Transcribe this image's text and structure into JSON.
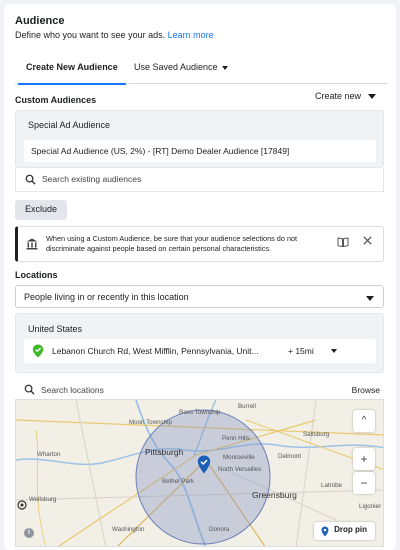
{
  "header": {
    "title": "Audience",
    "subtitle": "Define who you want to see your ads.",
    "learn_more": "Learn more"
  },
  "tabs": [
    {
      "label": "Create New Audience",
      "active": true
    },
    {
      "label": "Use Saved Audience",
      "active": false
    }
  ],
  "custom_audiences": {
    "label": "Custom Audiences",
    "create_new": "Create new",
    "box_label": "Special Ad Audience",
    "selected": "Special Ad Audience (US, 2%) - [RT] Demo Dealer Audience [17849]",
    "search_placeholder": "Search existing audiences",
    "exclude_label": "Exclude"
  },
  "notice": {
    "text": "When using a Custom Audience, be sure that your audience selections do not discriminate against people based on certain personal characteristics."
  },
  "locations": {
    "label": "Locations",
    "type_selected": "People living in or recently in this location",
    "country": "United States",
    "location_name": "Lebanon Church Rd, West Mifflin, Pennsylvania, Unit...",
    "radius": "+ 15mi",
    "search_placeholder": "Search locations",
    "browse": "Browse"
  },
  "map": {
    "labels": [
      "Burrell",
      "Ross Township",
      "Moon Township",
      "Penn Hills",
      "Saltsburg",
      "Pittsburgh",
      "Wharton",
      "Monroeville",
      "North Versailles",
      "Delmont",
      "Bethel Park",
      "Latrobe",
      "Greensburg",
      "Wellsburg",
      "Ligonier",
      "Washington",
      "Donora"
    ],
    "drop_pin": "Drop pin",
    "zoom_in": "+",
    "zoom_out": "−",
    "up": "^",
    "info": "i",
    "accent": "#1877f2",
    "pin_color": "#1c5fb8",
    "location_pin_color": "#42b72a"
  }
}
